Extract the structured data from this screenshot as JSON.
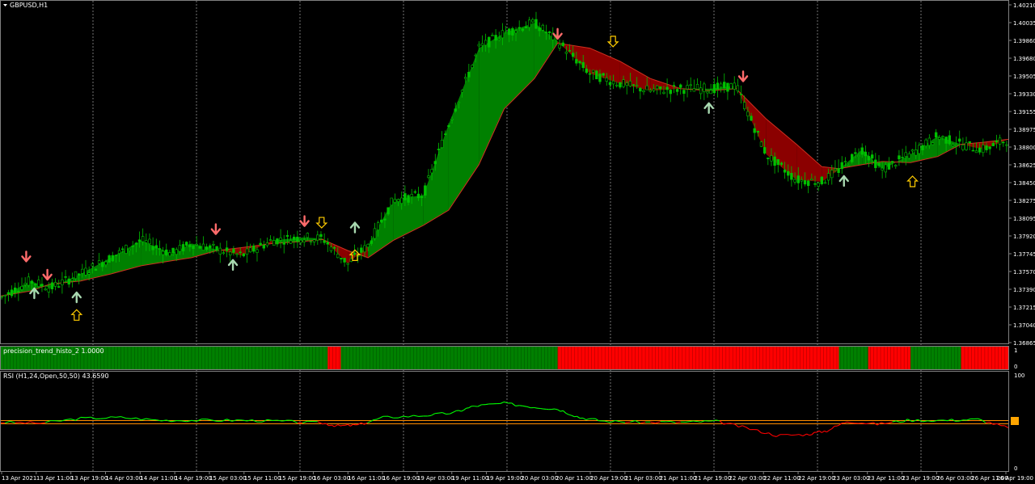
{
  "window": {
    "title": "GBPUSD,H1"
  },
  "colors": {
    "background": "#000000",
    "bull_fill": "#008000",
    "bear_fill": "#8b0000",
    "candle": "#00c000",
    "frame": "#808080",
    "grid": "#c0c0c0",
    "arrow_buy": "#a8d8b0",
    "arrow_sell": "#ff6b6b",
    "arrow_signal": "#ffcc00",
    "histo_green": "#008000",
    "histo_red": "#ff0000",
    "rsi_up": "#00ff00",
    "rsi_down": "#ff0000",
    "rsi_level": "#ff8c00",
    "rsi_marker": "#ffa500"
  },
  "price_axis": {
    "labels": [
      "1.40210",
      "1.40035",
      "1.39860",
      "1.39680",
      "1.39505",
      "1.39330",
      "1.39155",
      "1.38975",
      "1.38800",
      "1.38625",
      "1.38450",
      "1.38275",
      "1.38095",
      "1.37920",
      "1.37745",
      "1.37570",
      "1.37390",
      "1.37215",
      "1.37040",
      "1.36865"
    ],
    "max": 1.4021,
    "min": 1.36865
  },
  "time_axis": {
    "labels": [
      "13 Apr 2021",
      "13 Apr 11:00",
      "13 Apr 19:00",
      "14 Apr 03:00",
      "14 Apr 11:00",
      "14 Apr 19:00",
      "15 Apr 03:00",
      "15 Apr 11:00",
      "15 Apr 19:00",
      "16 Apr 03:00",
      "16 Apr 11:00",
      "16 Apr 19:00",
      "19 Apr 03:00",
      "19 Apr 11:00",
      "19 Apr 19:00",
      "20 Apr 03:00",
      "20 Apr 11:00",
      "20 Apr 19:00",
      "21 Apr 03:00",
      "21 Apr 11:00",
      "21 Apr 19:00",
      "22 Apr 03:00",
      "22 Apr 11:00",
      "22 Apr 19:00",
      "23 Apr 03:00",
      "23 Apr 11:00",
      "23 Apr 19:00",
      "26 Apr 03:00",
      "26 Apr 11:00",
      "26 Apr 19:00"
    ]
  },
  "histo_panel": {
    "title": "precision_trend_histo_2 1.0000",
    "axis_top": "1",
    "axis_bottom": "0",
    "segments": [
      {
        "trend": "up",
        "from": 0,
        "to": 0.325
      },
      {
        "trend": "down",
        "from": 0.325,
        "to": 0.338
      },
      {
        "trend": "up",
        "from": 0.338,
        "to": 0.553
      },
      {
        "trend": "down",
        "from": 0.553,
        "to": 0.832
      },
      {
        "trend": "up",
        "from": 0.832,
        "to": 0.861
      },
      {
        "trend": "down",
        "from": 0.861,
        "to": 0.903
      },
      {
        "trend": "up",
        "from": 0.903,
        "to": 0.953
      },
      {
        "trend": "down",
        "from": 0.953,
        "to": 1.0
      }
    ]
  },
  "rsi_panel": {
    "title": "RSI (H1,24,Open,50,50) 43.6590",
    "axis_top": "100",
    "axis_bottom": "0",
    "level": 50,
    "current_value": "43.6590"
  },
  "chart_data": {
    "type": "candlestick",
    "symbol": "GBPUSD",
    "timeframe": "H1",
    "ylim": [
      1.36865,
      1.4021
    ],
    "trend_band": [
      {
        "x": 0.0,
        "close": 1.3728,
        "ma": 1.373
      },
      {
        "x": 0.03,
        "close": 1.3745,
        "ma": 1.3735
      },
      {
        "x": 0.05,
        "close": 1.3738,
        "ma": 1.3742
      },
      {
        "x": 0.08,
        "close": 1.3752,
        "ma": 1.3745
      },
      {
        "x": 0.11,
        "close": 1.3768,
        "ma": 1.3752
      },
      {
        "x": 0.14,
        "close": 1.3785,
        "ma": 1.376
      },
      {
        "x": 0.17,
        "close": 1.3772,
        "ma": 1.3765
      },
      {
        "x": 0.19,
        "close": 1.3782,
        "ma": 1.3768
      },
      {
        "x": 0.215,
        "close": 1.3776,
        "ma": 1.3775
      },
      {
        "x": 0.24,
        "close": 1.377,
        "ma": 1.3778
      },
      {
        "x": 0.27,
        "close": 1.3785,
        "ma": 1.3782
      },
      {
        "x": 0.3,
        "close": 1.3788,
        "ma": 1.3784
      },
      {
        "x": 0.32,
        "close": 1.3787,
        "ma": 1.3786
      },
      {
        "x": 0.345,
        "close": 1.3762,
        "ma": 1.3775
      },
      {
        "x": 0.365,
        "close": 1.378,
        "ma": 1.3768
      },
      {
        "x": 0.39,
        "close": 1.3825,
        "ma": 1.3785
      },
      {
        "x": 0.42,
        "close": 1.383,
        "ma": 1.38
      },
      {
        "x": 0.445,
        "close": 1.39,
        "ma": 1.3815
      },
      {
        "x": 0.475,
        "close": 1.3975,
        "ma": 1.386
      },
      {
        "x": 0.5,
        "close": 1.399,
        "ma": 1.3915
      },
      {
        "x": 0.53,
        "close": 1.4,
        "ma": 1.3945
      },
      {
        "x": 0.553,
        "close": 1.3982,
        "ma": 1.398
      },
      {
        "x": 0.585,
        "close": 1.395,
        "ma": 1.3975
      },
      {
        "x": 0.615,
        "close": 1.394,
        "ma": 1.3962
      },
      {
        "x": 0.645,
        "close": 1.3933,
        "ma": 1.3945
      },
      {
        "x": 0.675,
        "close": 1.3935,
        "ma": 1.3935
      },
      {
        "x": 0.705,
        "close": 1.3935,
        "ma": 1.3933
      },
      {
        "x": 0.73,
        "close": 1.3938,
        "ma": 1.3935
      },
      {
        "x": 0.76,
        "close": 1.387,
        "ma": 1.3905
      },
      {
        "x": 0.79,
        "close": 1.3845,
        "ma": 1.388
      },
      {
        "x": 0.815,
        "close": 1.3843,
        "ma": 1.3858
      },
      {
        "x": 0.832,
        "close": 1.3855,
        "ma": 1.3856
      },
      {
        "x": 0.855,
        "close": 1.3875,
        "ma": 1.386
      },
      {
        "x": 0.875,
        "close": 1.3855,
        "ma": 1.3863
      },
      {
        "x": 0.903,
        "close": 1.387,
        "ma": 1.3862
      },
      {
        "x": 0.93,
        "close": 1.3888,
        "ma": 1.3868
      },
      {
        "x": 0.953,
        "close": 1.388,
        "ma": 1.388
      },
      {
        "x": 0.975,
        "close": 1.3875,
        "ma": 1.3882
      },
      {
        "x": 1.0,
        "close": 1.3885,
        "ma": 1.3885
      }
    ],
    "signals": [
      {
        "type": "sell",
        "x": 0.026,
        "price": 1.377
      },
      {
        "type": "buy",
        "x": 0.034,
        "price": 1.3732
      },
      {
        "type": "sell",
        "x": 0.047,
        "price": 1.3752
      },
      {
        "type": "buy",
        "x": 0.076,
        "price": 1.3728
      },
      {
        "type": "sell",
        "x": 0.214,
        "price": 1.3797
      },
      {
        "type": "buy",
        "x": 0.231,
        "price": 1.376
      },
      {
        "type": "sell",
        "x": 0.302,
        "price": 1.3805
      },
      {
        "type": "buy",
        "x": 0.352,
        "price": 1.3797
      },
      {
        "type": "sell",
        "x": 0.553,
        "price": 1.399
      },
      {
        "type": "buy",
        "x": 0.703,
        "price": 1.3915
      },
      {
        "type": "sell",
        "x": 0.737,
        "price": 1.3948
      },
      {
        "type": "buy",
        "x": 0.837,
        "price": 1.3843
      }
    ],
    "arrows": [
      {
        "type": "up",
        "x": 0.076,
        "price": 1.3711
      },
      {
        "type": "down",
        "x": 0.319,
        "price": 1.3803
      },
      {
        "type": "up",
        "x": 0.352,
        "price": 1.377
      },
      {
        "type": "down",
        "x": 0.608,
        "price": 1.3982
      },
      {
        "type": "up",
        "x": 0.905,
        "price": 1.3843
      }
    ],
    "histogram": {
      "trend_values": "see histo_panel.segments"
    },
    "rsi": [
      {
        "x": 0.0,
        "v": 50
      },
      {
        "x": 0.04,
        "v": 49
      },
      {
        "x": 0.08,
        "v": 54
      },
      {
        "x": 0.12,
        "v": 55
      },
      {
        "x": 0.16,
        "v": 52
      },
      {
        "x": 0.2,
        "v": 52
      },
      {
        "x": 0.24,
        "v": 52
      },
      {
        "x": 0.28,
        "v": 51
      },
      {
        "x": 0.32,
        "v": 49
      },
      {
        "x": 0.335,
        "v": 46
      },
      {
        "x": 0.355,
        "v": 47
      },
      {
        "x": 0.38,
        "v": 55
      },
      {
        "x": 0.42,
        "v": 57
      },
      {
        "x": 0.45,
        "v": 60
      },
      {
        "x": 0.47,
        "v": 67
      },
      {
        "x": 0.5,
        "v": 70
      },
      {
        "x": 0.53,
        "v": 66
      },
      {
        "x": 0.553,
        "v": 64
      },
      {
        "x": 0.575,
        "v": 55
      },
      {
        "x": 0.6,
        "v": 51
      },
      {
        "x": 0.64,
        "v": 50
      },
      {
        "x": 0.68,
        "v": 50
      },
      {
        "x": 0.71,
        "v": 51
      },
      {
        "x": 0.74,
        "v": 44
      },
      {
        "x": 0.77,
        "v": 36
      },
      {
        "x": 0.8,
        "v": 37
      },
      {
        "x": 0.82,
        "v": 41
      },
      {
        "x": 0.84,
        "v": 51
      },
      {
        "x": 0.87,
        "v": 48
      },
      {
        "x": 0.9,
        "v": 52
      },
      {
        "x": 0.94,
        "v": 52
      },
      {
        "x": 0.97,
        "v": 53
      },
      {
        "x": 1.0,
        "v": 44
      }
    ]
  }
}
